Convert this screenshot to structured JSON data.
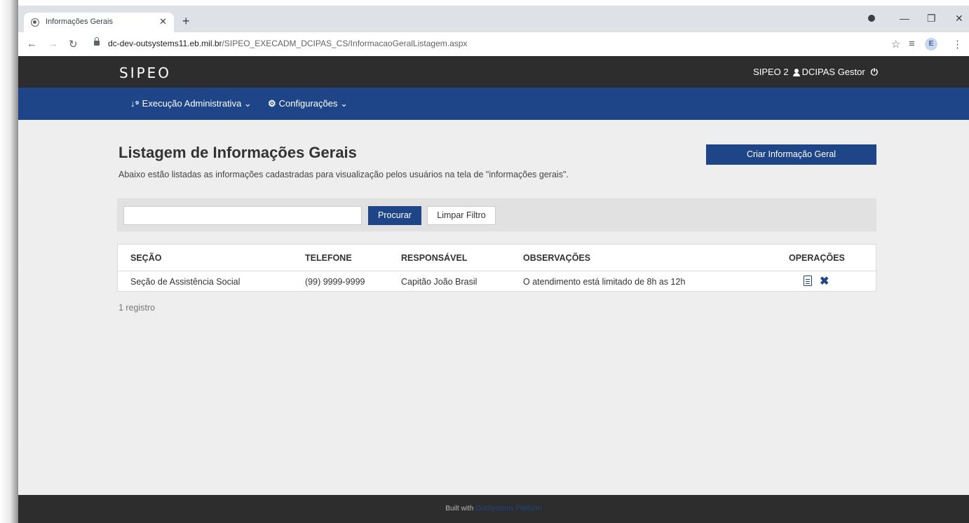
{
  "browser": {
    "tab_title": "Informações Gerais",
    "tab_close": "✕",
    "new_tab": "+",
    "url_host": "dc-dev-outsystems11.eb.mil.br",
    "url_path": "/SIPEO_EXECADM_DCIPAS_CS/InformacaoGeralListagem.aspx",
    "avatar_letter": "E"
  },
  "app": {
    "logo": "SIPEO",
    "user_area": {
      "system": "SIPEO 2",
      "user": "DCIPAS Gestor"
    },
    "menu": [
      {
        "icon": "sort-numeric-icon",
        "label": "Execução Administrativa"
      },
      {
        "icon": "gears-icon",
        "label": "Configurações"
      }
    ]
  },
  "page": {
    "title": "Listagem de Informações Gerais",
    "description": "Abaixo estão listadas as informações cadastradas para visualização pelos usuários na tela de \"informações gerais\".",
    "create_button": "Criar Informação Geral",
    "search": {
      "value": "",
      "button": "Procurar",
      "clear_button": "Limpar Filtro"
    },
    "table": {
      "headers": [
        "SEÇÃO",
        "TELEFONE",
        "RESPONSÁVEL",
        "OBSERVAÇÕES",
        "OPERAÇÕES"
      ],
      "rows": [
        [
          "Seção de Assistência Social",
          "(99) 9999-9999",
          "Capitão João Brasil",
          "O atendimento está limitado de 8h as 12h"
        ]
      ]
    },
    "record_count": "1 registro"
  },
  "footer": {
    "built_with": "Built with",
    "platform": "OutSystems Platform"
  },
  "colors": {
    "primary": "#1d4587",
    "topbar": "#2d2d2d",
    "page_bg": "#eeeeee"
  }
}
